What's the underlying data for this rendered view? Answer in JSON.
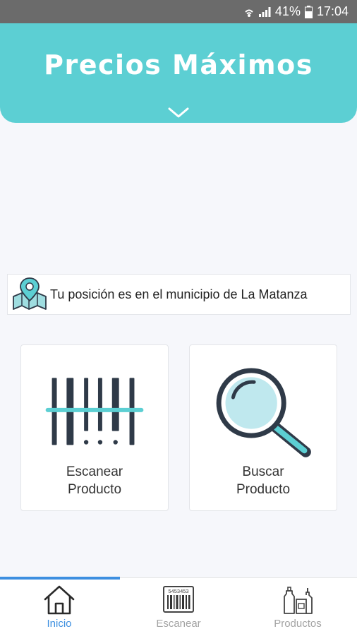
{
  "status_bar": {
    "battery": "41%",
    "time": "17:04"
  },
  "header": {
    "title": "Precios Máximos"
  },
  "location": {
    "message": "Tu posición es en el municipio de La Matanza"
  },
  "cards": {
    "scan": {
      "line1": "Escanear",
      "line2": "Producto"
    },
    "search": {
      "line1": "Buscar",
      "line2": "Producto"
    }
  },
  "nav": {
    "tabs": [
      {
        "label": "Inicio",
        "icon": "home-icon",
        "active": true
      },
      {
        "label": "Escanear",
        "icon": "barcode-icon",
        "active": false
      },
      {
        "label": "Productos",
        "icon": "products-icon",
        "active": false
      }
    ],
    "barcode_number": "5453453"
  },
  "colors": {
    "accent": "#5ccfd3",
    "active_tab": "#3d8fe0",
    "icon_dark": "#2f3a48",
    "lens": "#bfe8ee"
  }
}
